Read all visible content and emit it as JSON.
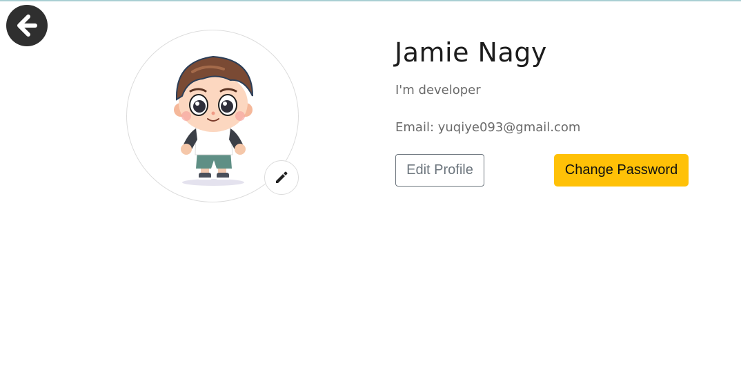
{
  "header": {
    "back_icon": "arrow-left-circle-icon"
  },
  "profile": {
    "avatar_icon": "cartoon-boy-avatar",
    "edit_avatar_icon": "pencil-icon",
    "name": "Jamie Nagy",
    "bio": "I'm developer",
    "email": "Email: yuqiye093@gmail.com"
  },
  "actions": {
    "edit_profile_label": "Edit Profile",
    "change_password_label": "Change Password"
  },
  "colors": {
    "accent": "#ffc107",
    "secondary": "#6c757d",
    "back_button": "#2f2f2f"
  }
}
